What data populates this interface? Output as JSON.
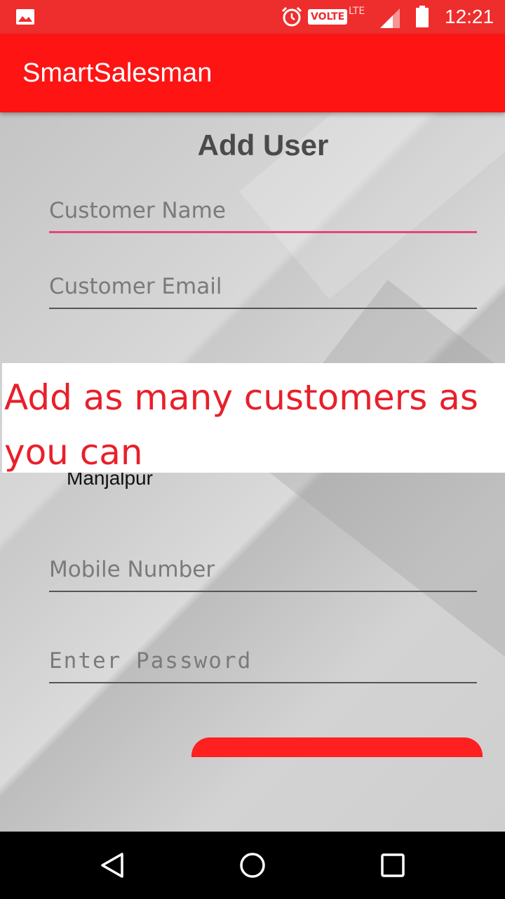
{
  "status_bar": {
    "time": "12:21",
    "volte": "VOLTE",
    "network": "LTE",
    "icons": [
      "gallery-icon",
      "alarm-icon",
      "signal-icon",
      "battery-icon"
    ]
  },
  "app_bar": {
    "title": "SmartSalesman",
    "color": "#ff1414"
  },
  "form": {
    "heading": "Add User",
    "customer_name_placeholder": "Customer Name",
    "customer_email_placeholder": "Customer Email",
    "area_value": "Manjalpur",
    "mobile_placeholder": "Mobile Number",
    "password_placeholder": "Enter Password",
    "focus_color": "#e8437a"
  },
  "overlay": {
    "caption": "Add as many customers as you can",
    "text_color": "#e8202a"
  },
  "nav_bar": {
    "buttons": [
      "back-icon",
      "home-icon",
      "recents-icon"
    ]
  }
}
